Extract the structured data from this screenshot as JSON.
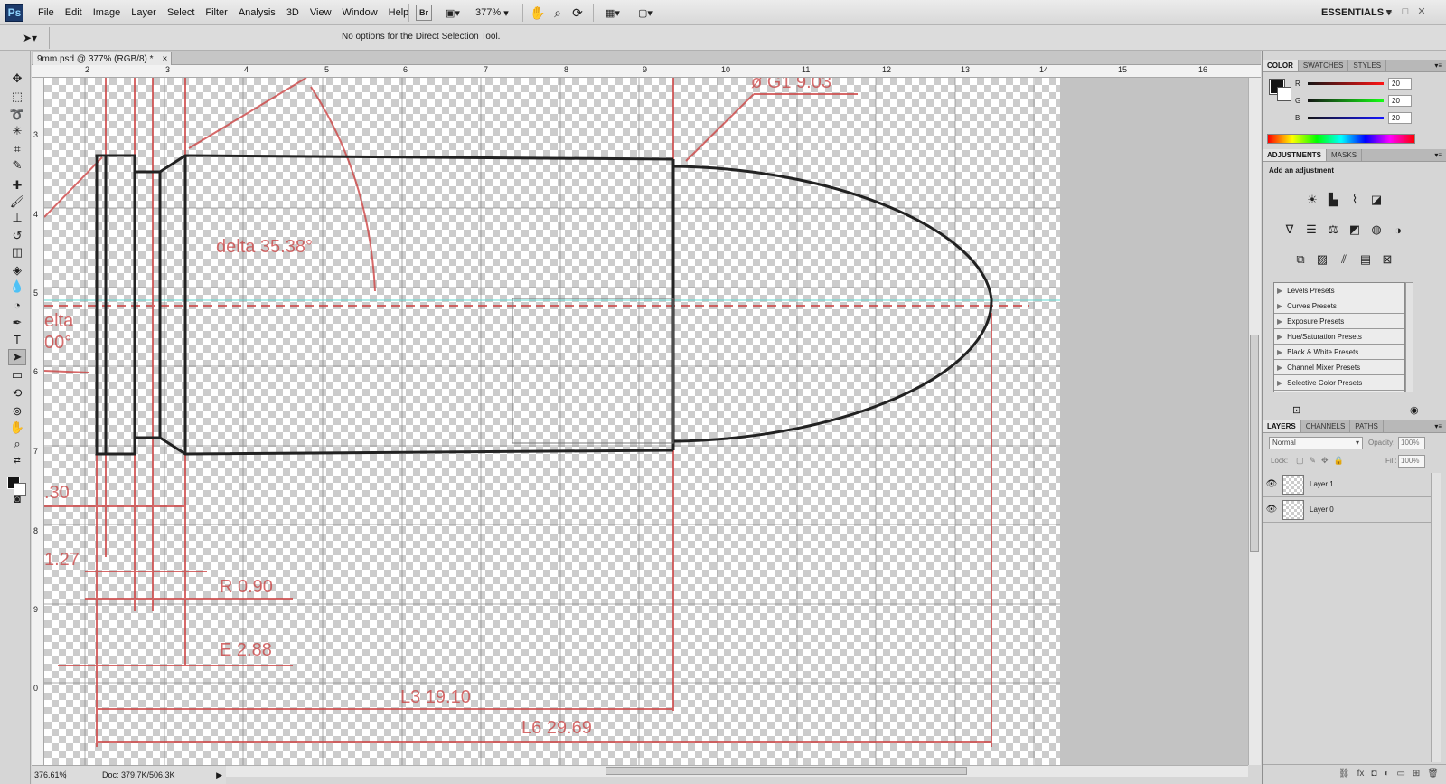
{
  "app": {
    "logo": "Ps",
    "menu": [
      "File",
      "Edit",
      "Image",
      "Layer",
      "Select",
      "Filter",
      "Analysis",
      "3D",
      "View",
      "Window",
      "Help"
    ],
    "zoom_level": "377%",
    "workspace": "ESSENTIALS",
    "window_controls": [
      "–",
      "□",
      "✕"
    ]
  },
  "options_bar": {
    "message": "No options for the Direct Selection Tool."
  },
  "document": {
    "tab_title": "9mm.psd @ 377% (RGB/8) *",
    "tab_close": "×"
  },
  "rulers": {
    "top_ticks": [
      "2",
      "3",
      "4",
      "5",
      "6",
      "7",
      "8",
      "9",
      "10",
      "11",
      "12",
      "13",
      "14",
      "15",
      "16"
    ],
    "left_ticks": [
      "3",
      "4",
      "5",
      "6",
      "7",
      "8",
      "9",
      "0"
    ]
  },
  "blueprint": {
    "delta_label": "delta  35.38°",
    "delta_left_label": "elta",
    "angle_left_label": "00°",
    "dia_top_label": "ø G1  9.03",
    "dim_30": ".30",
    "dim_127": "1.27",
    "dim_r": "R  0.90",
    "dim_e": "E  2.88",
    "dim_l3": "L3  19.10",
    "dim_l6": "L6  29.69"
  },
  "status": {
    "zoom": "376.61%",
    "doc_size": "Doc: 379.7K/506.3K"
  },
  "color_panel": {
    "tabs": [
      "COLOR",
      "SWATCHES",
      "STYLES"
    ],
    "channels": [
      {
        "label": "R",
        "value": "20",
        "color": "#d01010"
      },
      {
        "label": "G",
        "value": "20",
        "color": "#10a010"
      },
      {
        "label": "B",
        "value": "20",
        "color": "#1020c0"
      }
    ],
    "foreground": "#141414",
    "background": "#ffffff"
  },
  "adjustments_panel": {
    "tabs": [
      "ADJUSTMENTS",
      "MASKS"
    ],
    "heading": "Add an adjustment",
    "icons_row1": [
      "brightness-icon",
      "levels-icon",
      "curves-icon",
      "exposure-icon"
    ],
    "icons_row2": [
      "vibrance-icon",
      "hue-saturation-icon",
      "color-balance-icon",
      "black-white-icon",
      "photo-filter-icon",
      "channel-mixer-icon"
    ],
    "icons_row3": [
      "invert-icon",
      "posterize-icon",
      "threshold-icon",
      "gradient-map-icon",
      "selective-color-icon"
    ],
    "presets": [
      "Levels Presets",
      "Curves Presets",
      "Exposure Presets",
      "Hue/Saturation Presets",
      "Black & White Presets",
      "Channel Mixer Presets",
      "Selective Color Presets"
    ]
  },
  "layers_panel": {
    "tabs": [
      "LAYERS",
      "CHANNELS",
      "PATHS"
    ],
    "blend_mode": "Normal",
    "opacity_label": "Opacity:",
    "opacity": "100%",
    "lock_label": "Lock:",
    "fill_label": "Fill:",
    "fill": "100%",
    "layers": [
      {
        "name": "Layer 1",
        "visible": true
      },
      {
        "name": "Layer 0",
        "visible": true
      }
    ]
  }
}
